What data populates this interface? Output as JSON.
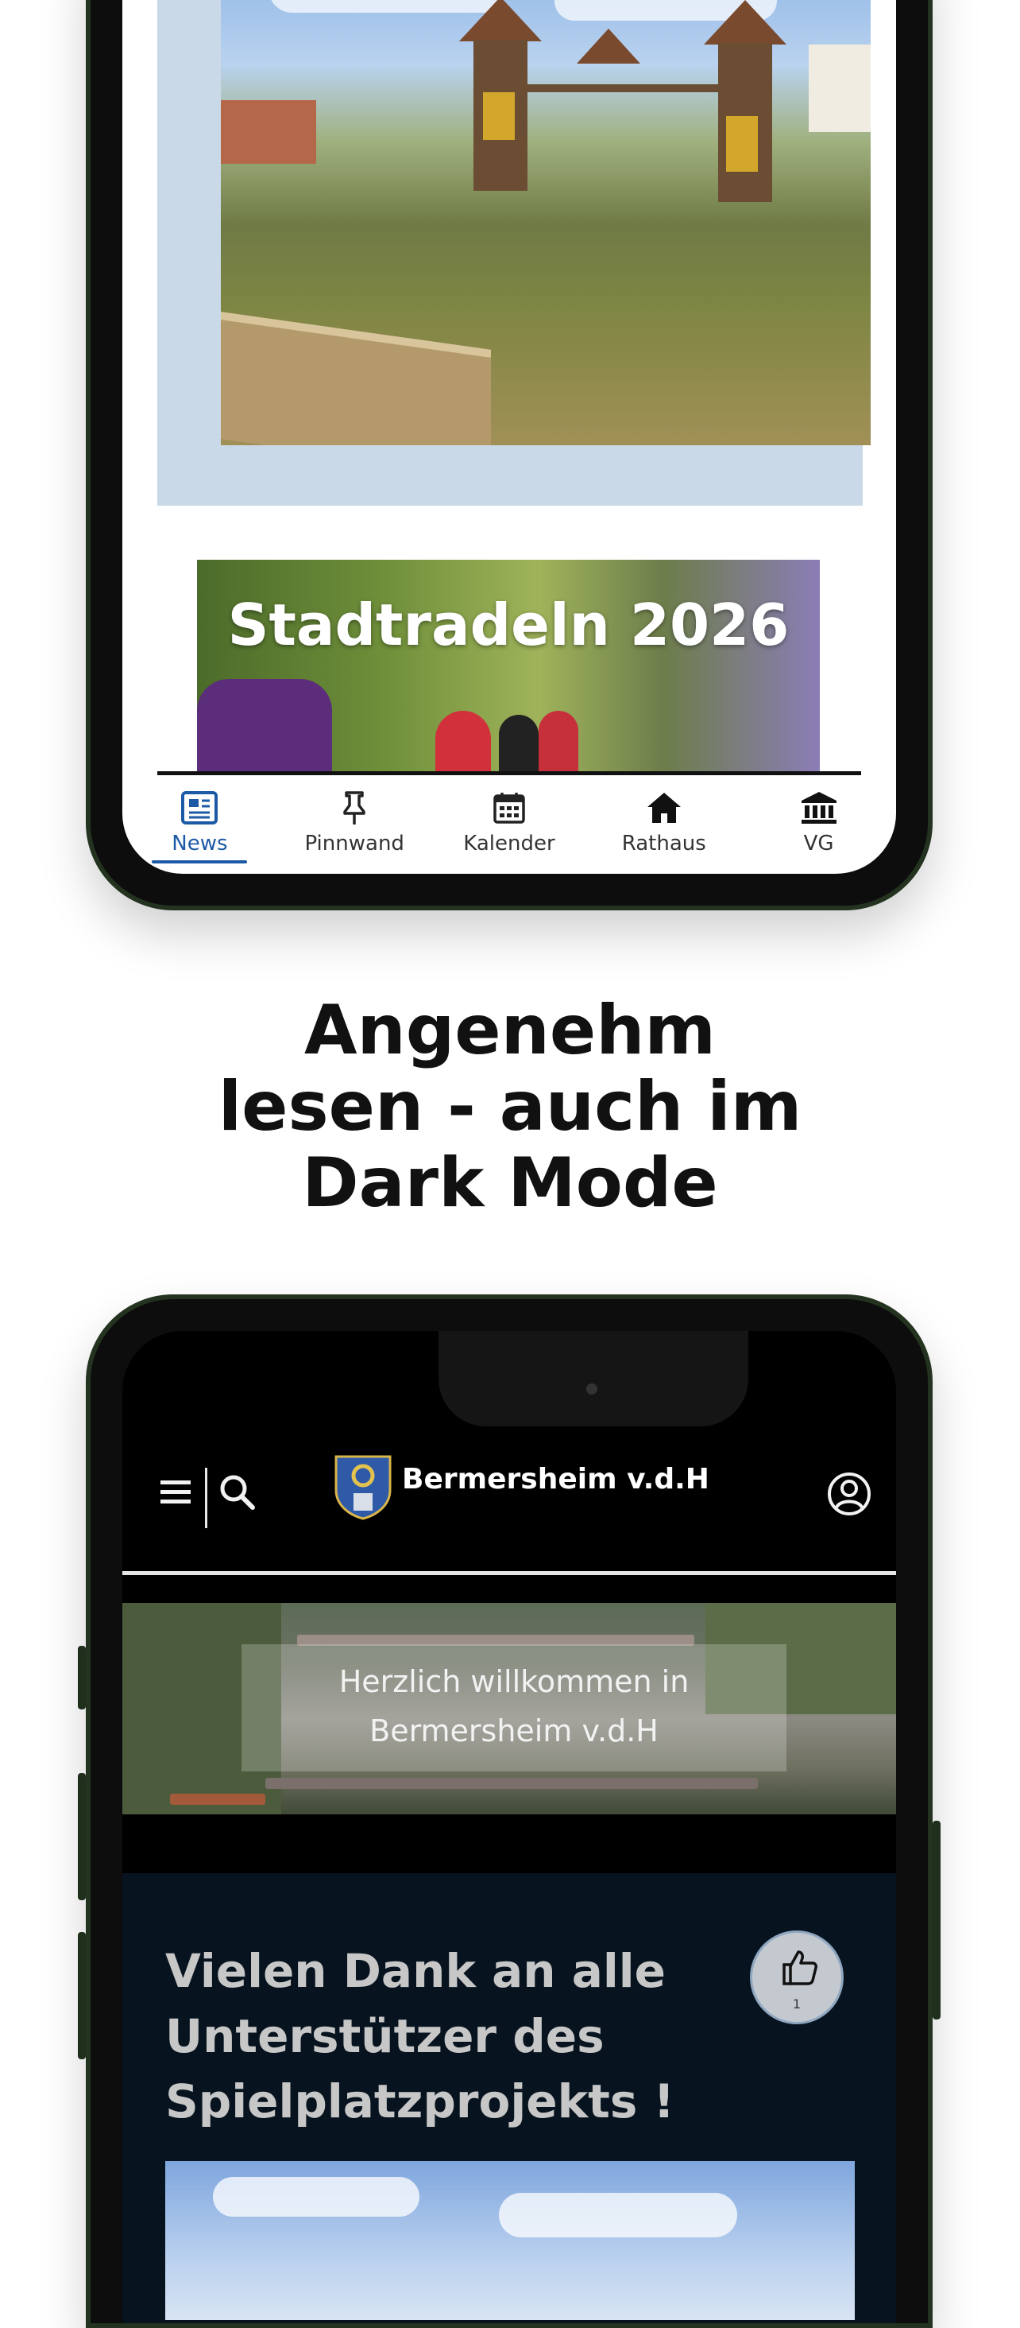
{
  "tabs": [
    {
      "label": "News",
      "icon": "newspaper-icon",
      "active": true
    },
    {
      "label": "Pinnwand",
      "icon": "pin-icon",
      "active": false
    },
    {
      "label": "Kalender",
      "icon": "calendar-icon",
      "active": false
    },
    {
      "label": "Rathaus",
      "icon": "home-icon",
      "active": false
    },
    {
      "label": "VG",
      "icon": "bank-icon",
      "active": false
    }
  ],
  "banner": {
    "title": "Stadtradeln 2026"
  },
  "headline": {
    "line1": "Angenehm",
    "line2": "lesen - auch im",
    "line3": "Dark Mode"
  },
  "app": {
    "title": "Bermersheim v.d.H"
  },
  "hero": {
    "line1": "Herzlich willkommen in",
    "line2": "Bermersheim v.d.H"
  },
  "article": {
    "title_line1": "Vielen Dank an alle",
    "title_line2": "Unterstützer des",
    "title_line3": "Spielplatzprojekts !",
    "likes": "1"
  },
  "colors": {
    "accent": "#1d5aa6",
    "phone_frame": "#23331f",
    "dark_card": "#07141f"
  }
}
